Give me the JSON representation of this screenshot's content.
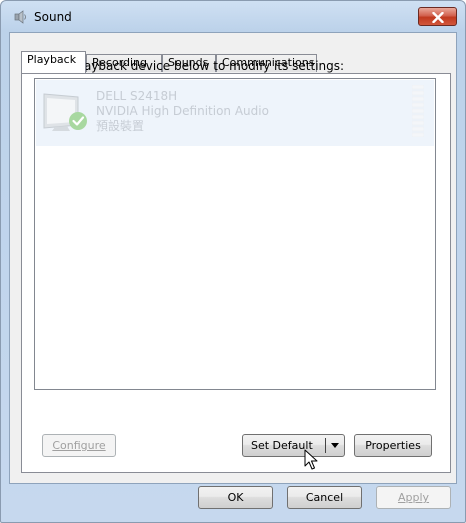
{
  "window": {
    "title": "Sound"
  },
  "tabs": [
    "Playback",
    "Recording",
    "Sounds",
    "Communications"
  ],
  "playback": {
    "instruction": "Select a playback device below to modify its settings:",
    "devices": [
      {
        "name": "DELL S2418H",
        "driver": "NVIDIA High Definition Audio",
        "status": "預設裝置",
        "default": true,
        "icon": "monitor-speaker-icon"
      }
    ],
    "buttons": {
      "configure": "Configure",
      "set_default": "Set Default",
      "properties": "Properties"
    }
  },
  "footer": {
    "ok": "OK",
    "cancel": "Cancel",
    "apply": "Apply"
  },
  "colors": {
    "close_button": "#c63f2a",
    "frame": "#c5d7ed",
    "selection": "#eef4fb"
  }
}
